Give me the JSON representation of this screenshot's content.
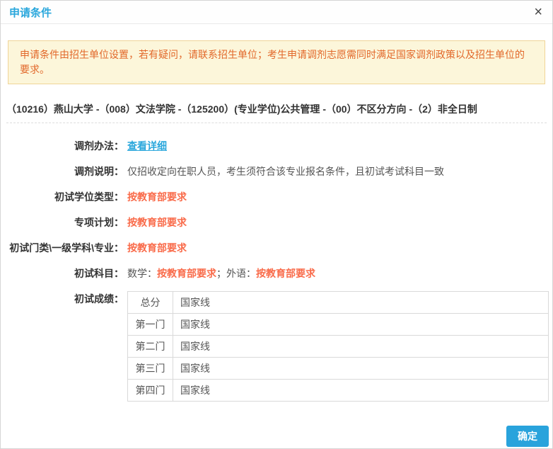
{
  "modal": {
    "title": "申请条件",
    "close_icon": "×"
  },
  "notice": "申请条件由招生单位设置，若有疑问，请联系招生单位；考生申请调剂志愿需同时满足国家调剂政策以及招生单位的要求。",
  "program": "（10216）燕山大学 -（008）文法学院 -（125200）(专业学位)公共管理 -（00）不区分方向 -（2）非全日制",
  "rows": {
    "method": {
      "label": "调剂办法：",
      "link_text": "查看详细"
    },
    "note": {
      "label": "调剂说明：",
      "value": "仅招收定向在职人员，考生须符合该专业报名条件，且初试考试科目一致"
    },
    "degree_type": {
      "label": "初试学位类型：",
      "value": "按教育部要求"
    },
    "special_plan": {
      "label": "专项计划：",
      "value": "按教育部要求"
    },
    "discipline": {
      "label": "初试门类\\一级学科\\专业：",
      "value": "按教育部要求"
    },
    "subjects": {
      "label": "初试科目：",
      "math_label": "数学：",
      "math_value": "按教育部要求",
      "separator": "；",
      "foreign_label": "外语：",
      "foreign_value": "按教育部要求"
    }
  },
  "scores": {
    "label": "初试成绩：",
    "table": [
      {
        "subject": "总分",
        "value": "国家线"
      },
      {
        "subject": "第一门",
        "value": "国家线"
      },
      {
        "subject": "第二门",
        "value": "国家线"
      },
      {
        "subject": "第三门",
        "value": "国家线"
      },
      {
        "subject": "第四门",
        "value": "国家线"
      }
    ]
  },
  "footer": {
    "confirm_label": "确定"
  },
  "colors": {
    "accent_blue": "#2aa7dc",
    "button_blue": "#29a3dc",
    "value_orange": "#f96b4a",
    "notice_text_orange": "#e2682a",
    "notice_background": "#fcf6da",
    "notice_border": "#f0d498"
  }
}
